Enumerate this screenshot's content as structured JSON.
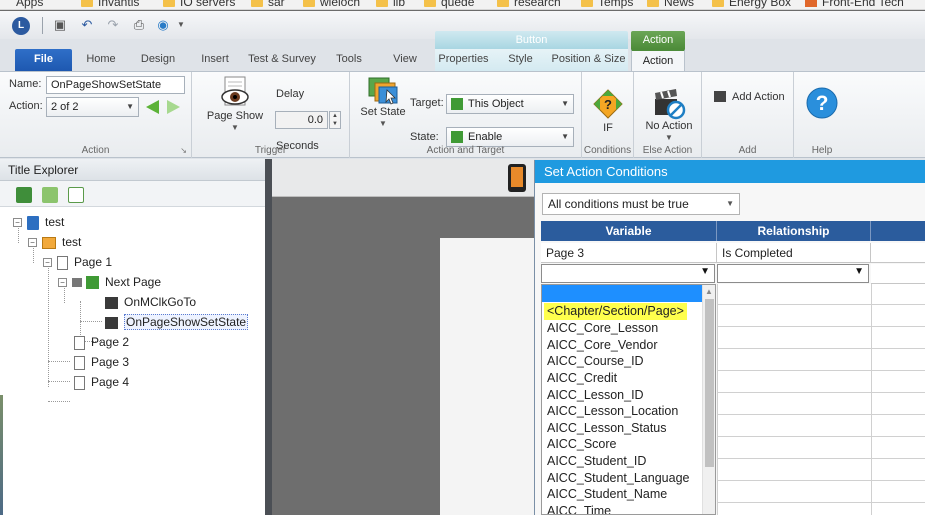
{
  "bookmarks": [
    "Apps",
    "Invantis",
    "IO servers",
    "sar",
    "wieloch",
    "lib",
    "quede",
    "research",
    "Temps",
    "News",
    "Energy Box",
    "Front-End Tech"
  ],
  "ribbon_context": {
    "button_group": "Button",
    "action_group": "Action"
  },
  "tabs": [
    "File",
    "Home",
    "Design",
    "Insert",
    "Test & Survey",
    "Tools",
    "View",
    "Properties",
    "Style",
    "Position & Size",
    "Action"
  ],
  "ribbon": {
    "action_group": {
      "name_label": "Name:",
      "name_value": "OnPageShowSetState",
      "action_label": "Action:",
      "action_value": "2 of 2",
      "label": "Action"
    },
    "trigger_group": {
      "page_show": "Page Show",
      "delay_label": "Delay",
      "delay_value": "0.0",
      "seconds_label": "Seconds",
      "label": "Trigger"
    },
    "action_target_group": {
      "set_state": "Set State",
      "target_label": "Target:",
      "target_value": "This Object",
      "state_label": "State:",
      "state_value": "Enable",
      "label": "Action and Target"
    },
    "conditions_group": {
      "if_label": "IF",
      "label": "Conditions"
    },
    "else_group": {
      "no_action": "No Action",
      "label": "Else Action"
    },
    "add_group": {
      "add_action": "Add Action",
      "label": "Add"
    },
    "help_group": {
      "label": "Help"
    }
  },
  "explorer": {
    "title": "Title Explorer",
    "tree": [
      "test",
      "test",
      "Page 1",
      "Next Page",
      "OnMClkGoTo",
      "OnPageShowSetState",
      "Page 2",
      "Page 3",
      "Page 4"
    ]
  },
  "dialog": {
    "title": "Set Action Conditions",
    "condition_mode": "All conditions must be true",
    "columns": [
      "Variable",
      "Relationship"
    ],
    "row1": {
      "variable": "Page 3",
      "relationship": "Is Completed"
    },
    "variable_options": [
      "<Chapter/Section/Page>",
      "AICC_Core_Lesson",
      "AICC_Core_Vendor",
      "AICC_Course_ID",
      "AICC_Credit",
      "AICC_Lesson_ID",
      "AICC_Lesson_Location",
      "AICC_Lesson_Status",
      "AICC_Score",
      "AICC_Student_ID",
      "AICC_Student_Language",
      "AICC_Student_Name",
      "AICC_Time"
    ]
  }
}
